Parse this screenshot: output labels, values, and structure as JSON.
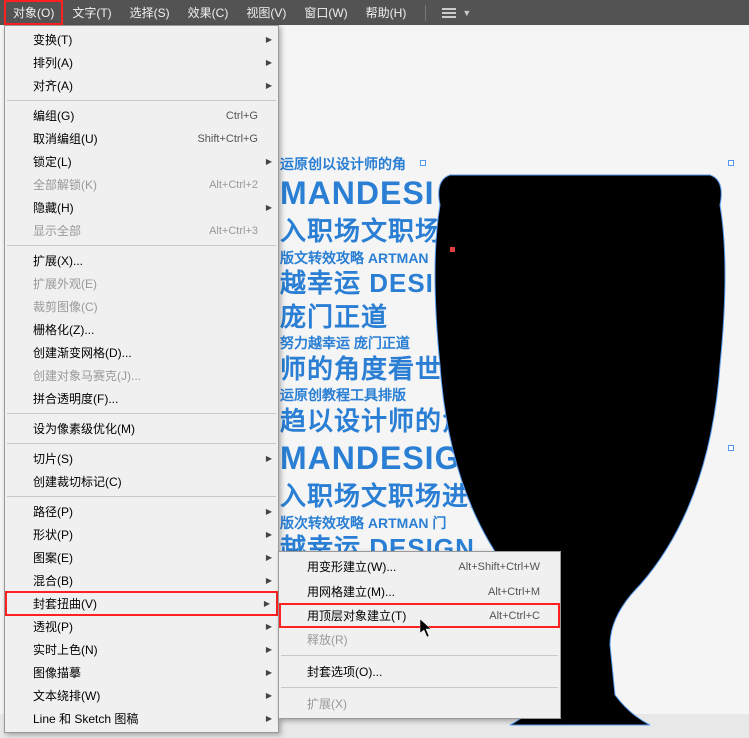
{
  "menubar": {
    "items": [
      {
        "label": "对象(O)",
        "highlighted": true
      },
      {
        "label": "文字(T)"
      },
      {
        "label": "选择(S)"
      },
      {
        "label": "效果(C)"
      },
      {
        "label": "视图(V)"
      },
      {
        "label": "窗口(W)"
      },
      {
        "label": "帮助(H)"
      }
    ]
  },
  "dropdown": {
    "sections": [
      [
        {
          "label": "变换(T)",
          "arrow": true
        },
        {
          "label": "排列(A)",
          "arrow": true
        },
        {
          "label": "对齐(A)",
          "arrow": true
        }
      ],
      [
        {
          "label": "编组(G)",
          "shortcut": "Ctrl+G"
        },
        {
          "label": "取消编组(U)",
          "shortcut": "Shift+Ctrl+G"
        },
        {
          "label": "锁定(L)",
          "arrow": true
        },
        {
          "label": "全部解锁(K)",
          "shortcut": "Alt+Ctrl+2",
          "disabled": true
        },
        {
          "label": "隐藏(H)",
          "arrow": true
        },
        {
          "label": "显示全部",
          "shortcut": "Alt+Ctrl+3",
          "disabled": true
        }
      ],
      [
        {
          "label": "扩展(X)..."
        },
        {
          "label": "扩展外观(E)",
          "disabled": true
        },
        {
          "label": "裁剪图像(C)",
          "disabled": true
        },
        {
          "label": "栅格化(Z)..."
        },
        {
          "label": "创建渐变网格(D)..."
        },
        {
          "label": "创建对象马赛克(J)...",
          "disabled": true
        },
        {
          "label": "拼合透明度(F)..."
        }
      ],
      [
        {
          "label": "设为像素级优化(M)"
        }
      ],
      [
        {
          "label": "切片(S)",
          "arrow": true
        },
        {
          "label": "创建裁切标记(C)"
        }
      ],
      [
        {
          "label": "路径(P)",
          "arrow": true
        },
        {
          "label": "形状(P)",
          "arrow": true
        },
        {
          "label": "图案(E)",
          "arrow": true
        },
        {
          "label": "混合(B)",
          "arrow": true
        },
        {
          "label": "封套扭曲(V)",
          "arrow": true,
          "redbox": true
        },
        {
          "label": "透视(P)",
          "arrow": true
        },
        {
          "label": "实时上色(N)",
          "arrow": true
        },
        {
          "label": "图像描摹",
          "arrow": true
        },
        {
          "label": "文本绕排(W)",
          "arrow": true
        },
        {
          "label": "Line 和 Sketch 图稿",
          "arrow": true
        }
      ]
    ]
  },
  "submenu": {
    "sections": [
      [
        {
          "label": "用变形建立(W)...",
          "shortcut": "Alt+Shift+Ctrl+W"
        },
        {
          "label": "用网格建立(M)...",
          "shortcut": "Alt+Ctrl+M"
        },
        {
          "label": "用顶层对象建立(T)",
          "shortcut": "Alt+Ctrl+C",
          "redbox": true
        },
        {
          "label": "释放(R)",
          "disabled": true
        }
      ],
      [
        {
          "label": "封套选项(O)..."
        }
      ],
      [
        {
          "label": "扩展(X)",
          "disabled": true
        }
      ]
    ]
  },
  "canvas_text": {
    "l1": "运原创以设计师的角",
    "l2": "MANDESI",
    "l3": "入职场文职场进阶文",
    "l4": "越幸运 DESIGN",
    "l5": "版文转效攻略 ARTMAN",
    "l6": "庞门正道",
    "l7": "努力越幸运 庞门正道",
    "l8": "师的角度看世界",
    "l9": "运原创教程工具排版",
    "l10": "趋以设计师的角",
    "l11": "MANDESIGN",
    "l12": "入职场文职场进阶 庞",
    "l13": "版次转效攻略 ARTMAN 门",
    "l14": "越幸运 DESIGN"
  }
}
